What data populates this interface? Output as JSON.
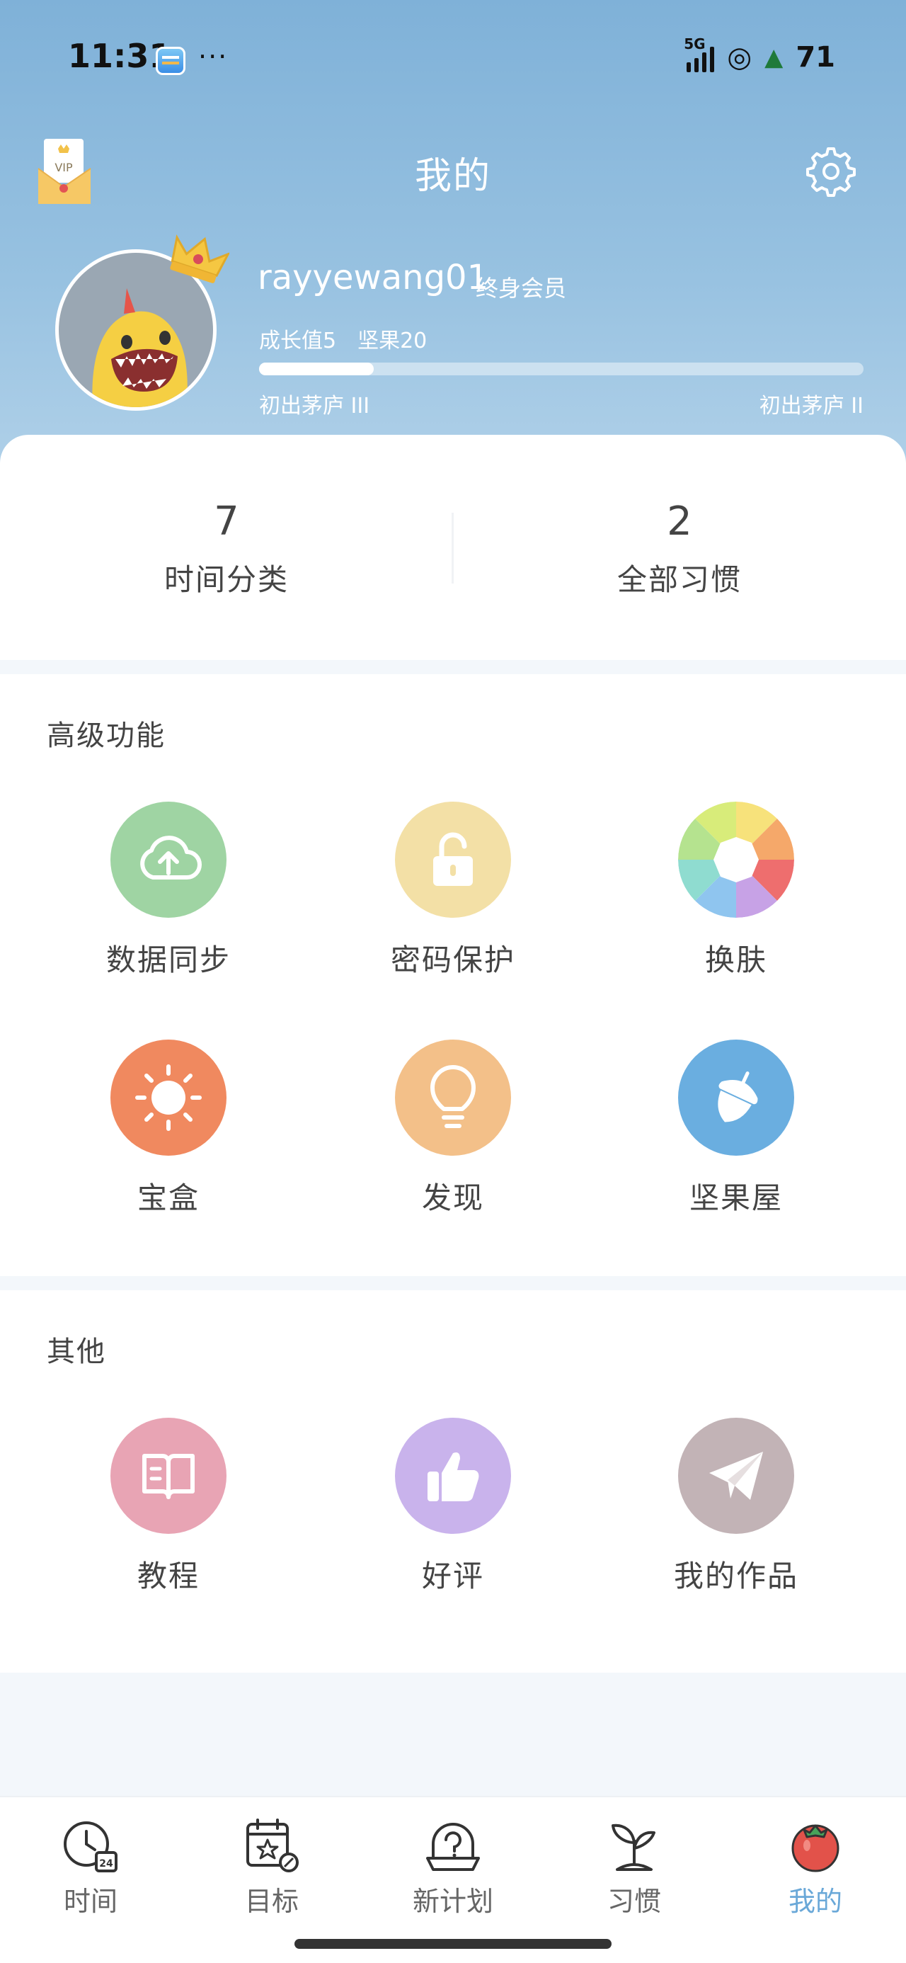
{
  "status_bar": {
    "time": "11:31",
    "dots": "···",
    "network": "5G",
    "battery": "71"
  },
  "header": {
    "title": "我的",
    "vip_badge": "VIP"
  },
  "profile": {
    "username": "rayyewang01",
    "membership": "终身会员",
    "growth": "成长值5",
    "nuts": "坚果20",
    "progress_fraction": 0.19,
    "level_current": "初出茅庐 III",
    "level_next": "初出茅庐 II"
  },
  "counters": [
    {
      "value": "7",
      "label": "时间分类"
    },
    {
      "value": "2",
      "label": "全部习惯"
    }
  ],
  "advanced": {
    "title": "高级功能",
    "items": [
      {
        "label": "数据同步",
        "icon": "cloud-upload-icon",
        "color": "#9fd4a3"
      },
      {
        "label": "密码保护",
        "icon": "unlock-icon",
        "color": "#f3e0a6"
      },
      {
        "label": "换肤",
        "icon": "palette-aperture-icon",
        "color": "#f5a86a"
      },
      {
        "label": "宝盒",
        "icon": "sun-icon",
        "color": "#f0895f"
      },
      {
        "label": "发现",
        "icon": "lightbulb-icon",
        "color": "#f3c089"
      },
      {
        "label": "坚果屋",
        "icon": "acorn-icon",
        "color": "#6aaee0"
      }
    ]
  },
  "others": {
    "title": "其他",
    "items": [
      {
        "label": "教程",
        "icon": "book-icon",
        "color": "#e8a4b4"
      },
      {
        "label": "好评",
        "icon": "thumbs-up-icon",
        "color": "#c9b3ec"
      },
      {
        "label": "我的作品",
        "icon": "paper-plane-icon",
        "color": "#c2b3b6"
      }
    ]
  },
  "nav": {
    "items": [
      {
        "label": "时间",
        "icon": "clock-calendar-icon",
        "active": false
      },
      {
        "label": "目标",
        "icon": "calendar-star-icon",
        "active": false
      },
      {
        "label": "新计划",
        "icon": "brain-plan-icon",
        "active": false
      },
      {
        "label": "习惯",
        "icon": "sprout-icon",
        "active": false
      },
      {
        "label": "我的",
        "icon": "tomato-icon",
        "active": true
      }
    ],
    "active_color": "#6aa8d8"
  }
}
